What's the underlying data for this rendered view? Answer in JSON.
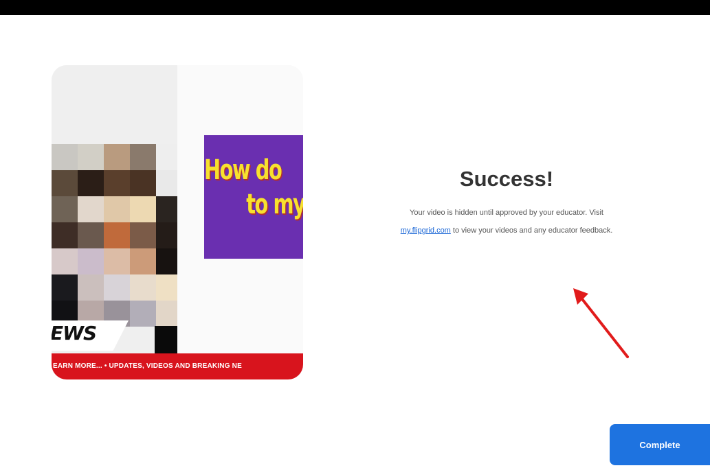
{
  "video": {
    "banner_line1": "How do",
    "banner_line2": "to my",
    "news_label": "EWS",
    "ticker_text": "EARN MORE...  •  UPDATES, VIDEOS AND BREAKING NE"
  },
  "success": {
    "title": "Success!",
    "message_before_link": "Your video is hidden until approved by your educator. Visit",
    "link_text": "my.flipgrid.com",
    "message_after_link": "to view your videos and any educator feedback."
  },
  "actions": {
    "complete_label": "Complete"
  },
  "colors": {
    "primary_button": "#1e73e0",
    "link": "#1a66d6",
    "annotation_arrow": "#e11b1b",
    "ticker": "#d8141d",
    "banner": "#6a2fb0"
  }
}
